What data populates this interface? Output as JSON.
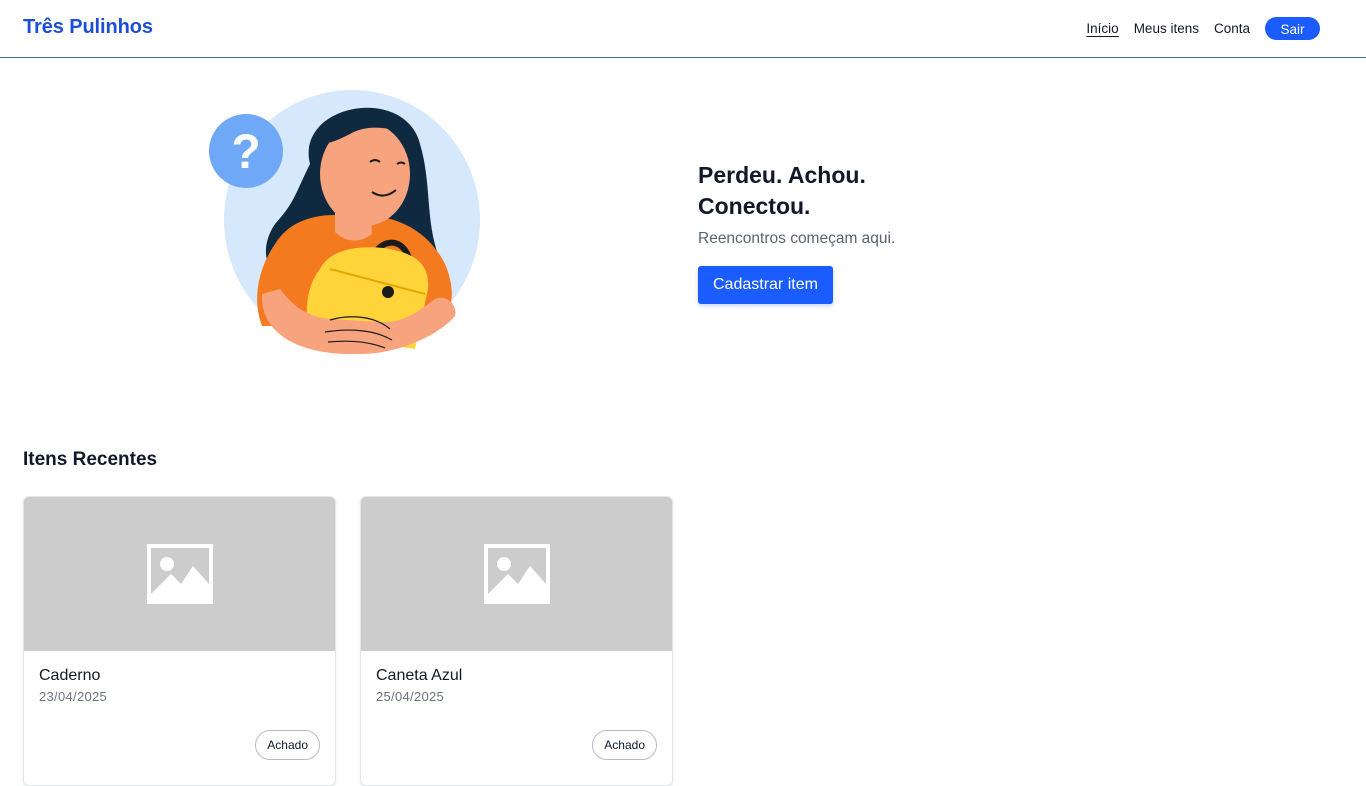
{
  "header": {
    "brand": "Três Pulinhos",
    "nav": {
      "home": "Início",
      "my_items": "Meus itens",
      "account": "Conta",
      "logout": "Sair"
    }
  },
  "hero": {
    "title": "Perdeu. Achou. Conectou.",
    "subtitle": "Reencontros começam aqui.",
    "cta_label": "Cadastrar item",
    "illustration": "woman-holding-bag-with-question-mark"
  },
  "recent": {
    "title": "Itens Recentes",
    "items": [
      {
        "name": "Caderno",
        "date": "23/04/2025",
        "status": "Achado",
        "image": "image-placeholder-icon"
      },
      {
        "name": "Caneta Azul",
        "date": "25/04/2025",
        "status": "Achado",
        "image": "image-placeholder-icon"
      }
    ]
  },
  "colors": {
    "brand": "#1d4ed8",
    "primary_button": "#1a5cff",
    "placeholder_bg": "#cccccc"
  }
}
